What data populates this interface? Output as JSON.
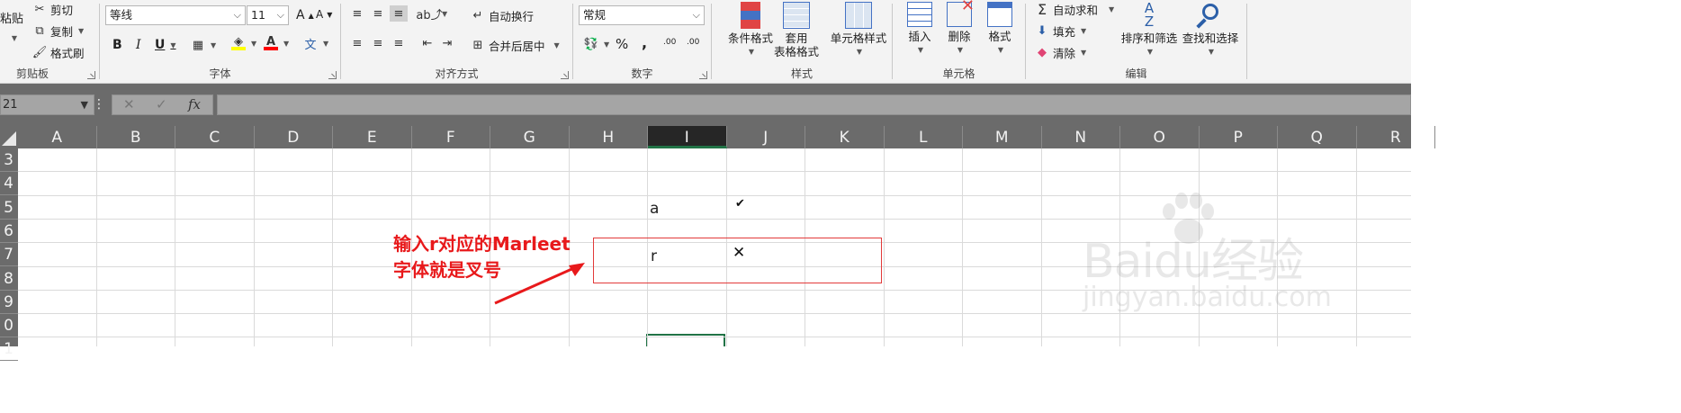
{
  "ribbon": {
    "clipboard": {
      "paste": "粘贴",
      "cut": "剪切",
      "copy": "复制",
      "format_painter": "格式刷",
      "group_label": "剪贴板"
    },
    "font": {
      "font_name": "等线",
      "font_size": "11",
      "bold": "B",
      "italic": "I",
      "underline": "U",
      "group_label": "字体",
      "increase": "A",
      "decrease": "A",
      "phonetic": "文"
    },
    "alignment": {
      "wrap_text": "自动换行",
      "merge_center": "合并后居中",
      "group_label": "对齐方式"
    },
    "number": {
      "format": "常规",
      "percent": "%",
      "comma": ",",
      "inc_decimal": ".00",
      "dec_decimal": ".00",
      "group_label": "数字"
    },
    "styles": {
      "conditional": "条件格式",
      "format_table_1": "套用",
      "format_table_2": "表格格式",
      "cell_styles": "单元格样式",
      "group_label": "样式"
    },
    "cells": {
      "insert": "插入",
      "delete": "删除",
      "format": "格式",
      "group_label": "单元格"
    },
    "editing": {
      "autosum": "自动求和",
      "fill": "填充",
      "clear": "清除",
      "sort_filter": "排序和筛选",
      "find_select": "查找和选择",
      "group_label": "编辑"
    }
  },
  "formula_bar": {
    "name_box": "21",
    "fx": "fx",
    "cancel": "✕",
    "enter": "✓"
  },
  "columns": [
    "A",
    "B",
    "C",
    "D",
    "E",
    "F",
    "G",
    "H",
    "I",
    "J",
    "K",
    "L",
    "M",
    "N",
    "O",
    "P",
    "Q",
    "R"
  ],
  "active_column": "I",
  "rows": [
    "3",
    "4",
    "5",
    "6",
    "7",
    "8",
    "9",
    "0",
    "1"
  ],
  "cells": {
    "I5": "a",
    "J5": "✔",
    "I7": "r",
    "J7": "✕"
  },
  "annotation": {
    "line1": "输入r对应的Marleet",
    "line2": "字体就是叉号",
    "color": "#e8191b"
  },
  "watermark": {
    "logo": "Baidu经验",
    "url": "jingyan.baidu.com"
  }
}
